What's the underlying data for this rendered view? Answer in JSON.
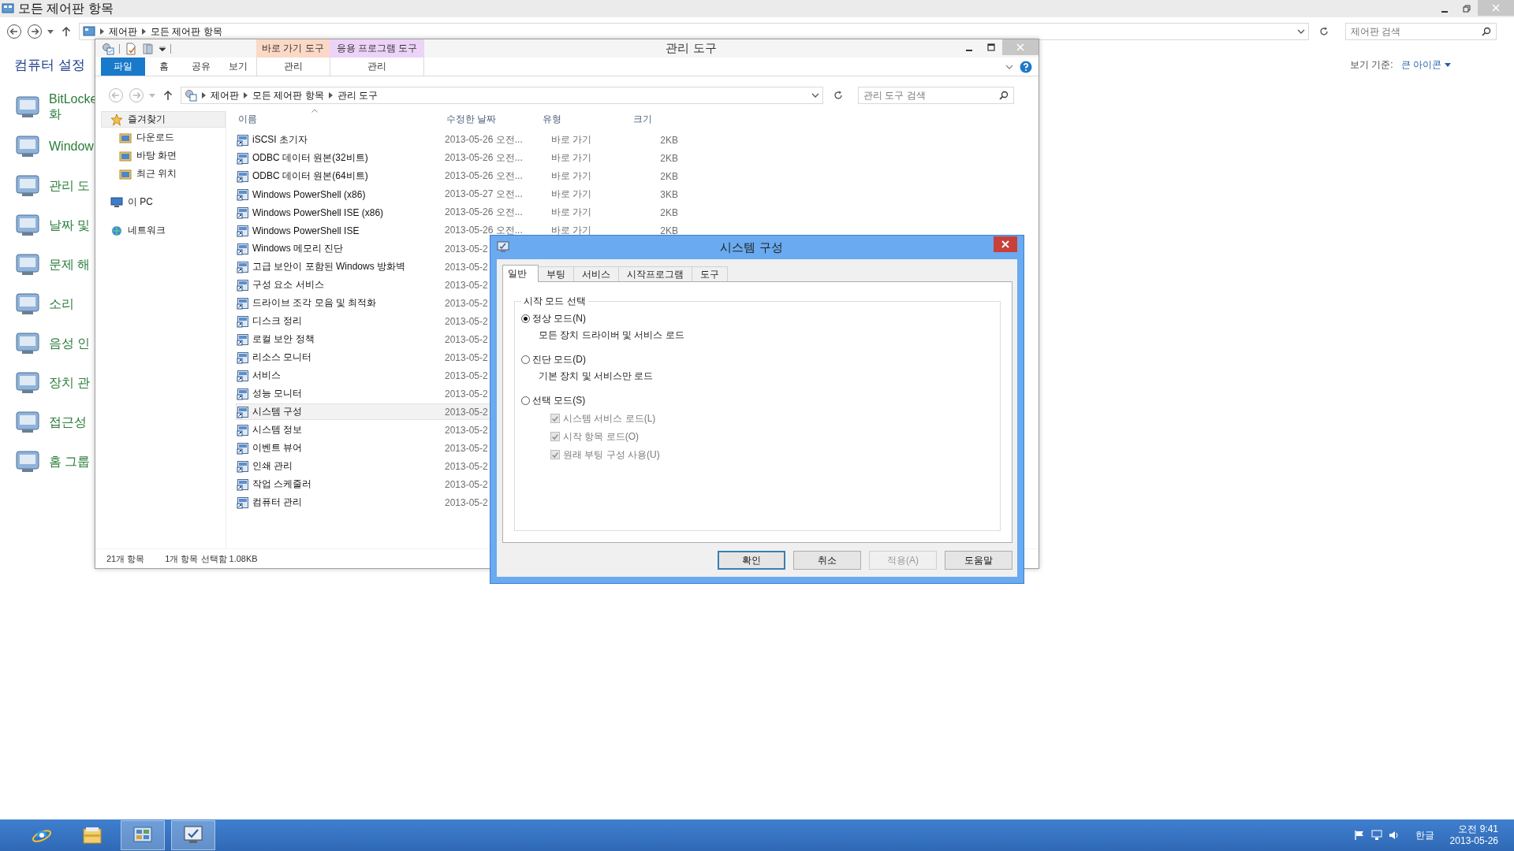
{
  "background_window": {
    "title": "모든 제어판 항목",
    "breadcrumb": [
      "제어판",
      "모든 제어판 항목"
    ],
    "search": {
      "placeholder": "제어판 검색"
    },
    "heading": "컴퓨터 설정",
    "view_by": {
      "label": "보기 기준:",
      "value": "큰 아이콘"
    },
    "items": [
      {
        "lines": [
          "BitLocke",
          "화"
        ]
      },
      {
        "lines": [
          "Window"
        ]
      },
      {
        "lines": [
          "관리 도"
        ]
      },
      {
        "lines": [
          "날짜 및"
        ]
      },
      {
        "lines": [
          "문제 해"
        ]
      },
      {
        "lines": [
          "소리"
        ]
      },
      {
        "lines": [
          "음성 인"
        ]
      },
      {
        "lines": [
          "장치 관"
        ]
      },
      {
        "lines": [
          "접근성"
        ]
      },
      {
        "lines": [
          "홈 그룹"
        ]
      }
    ]
  },
  "explorer": {
    "title": "관리 도구",
    "context_tabs": [
      {
        "label": "바로 가기 도구",
        "color": "#fbd9c6",
        "tab": {
          "label": "관리",
          "selected": false
        }
      },
      {
        "label": "응용 프로그램 도구",
        "color": "#ecd3f7",
        "tab": {
          "label": "관리",
          "selected": false
        }
      }
    ],
    "ribbon_tabs": [
      {
        "label": "파일",
        "selected": true
      },
      {
        "label": "홈",
        "selected": false
      },
      {
        "label": "공유",
        "selected": false
      },
      {
        "label": "보기",
        "selected": false
      }
    ],
    "breadcrumb": [
      "제어판",
      "모든 제어판 항목",
      "관리 도구"
    ],
    "search": {
      "placeholder": "관리 도구 검색"
    },
    "nav": [
      {
        "label": "즐겨찾기",
        "selected": true,
        "children": [
          {
            "label": "다운로드",
            "selected": false
          },
          {
            "label": "바탕 화면",
            "selected": false
          },
          {
            "label": "최근 위치",
            "selected": false
          }
        ]
      },
      {
        "label": "이 PC",
        "selected": false
      },
      {
        "label": "네트워크",
        "selected": false
      }
    ],
    "columns": [
      "이름",
      "수정한 날짜",
      "유형",
      "크기"
    ],
    "rows": [
      {
        "name": "iSCSI 초기자",
        "date": "2013-05-26 오전...",
        "type": "바로 가기",
        "size": "2KB",
        "selected": false
      },
      {
        "name": "ODBC 데이터 원본(32비트)",
        "date": "2013-05-26 오전...",
        "type": "바로 가기",
        "size": "2KB",
        "selected": false
      },
      {
        "name": "ODBC 데이터 원본(64비트)",
        "date": "2013-05-26 오전...",
        "type": "바로 가기",
        "size": "2KB",
        "selected": false
      },
      {
        "name": "Windows PowerShell (x86)",
        "date": "2013-05-27 오전...",
        "type": "바로 가기",
        "size": "3KB",
        "selected": false
      },
      {
        "name": "Windows PowerShell ISE (x86)",
        "date": "2013-05-26 오전...",
        "type": "바로 가기",
        "size": "2KB",
        "selected": false
      },
      {
        "name": "Windows PowerShell ISE",
        "date": "2013-05-26 오전...",
        "type": "바로 가기",
        "size": "2KB",
        "selected": false
      },
      {
        "name": "Windows 메모리 진단",
        "date": "2013-05-2",
        "selected": false
      },
      {
        "name": "고급 보안이 포함된 Windows 방화벽",
        "date": "2013-05-2",
        "selected": false
      },
      {
        "name": "구성 요소 서비스",
        "date": "2013-05-2",
        "selected": false
      },
      {
        "name": "드라이브 조각 모음 및 최적화",
        "date": "2013-05-2",
        "selected": false
      },
      {
        "name": "디스크 정리",
        "date": "2013-05-2",
        "selected": false
      },
      {
        "name": "로컬 보안 정책",
        "date": "2013-05-2",
        "selected": false
      },
      {
        "name": "리소스 모니터",
        "date": "2013-05-2",
        "selected": false
      },
      {
        "name": "서비스",
        "date": "2013-05-2",
        "selected": false
      },
      {
        "name": "성능 모니터",
        "date": "2013-05-2",
        "selected": false
      },
      {
        "name": "시스템 구성",
        "date": "2013-05-2",
        "selected": true
      },
      {
        "name": "시스템 정보",
        "date": "2013-05-2",
        "selected": false
      },
      {
        "name": "이벤트 뷰어",
        "date": "2013-05-2",
        "selected": false
      },
      {
        "name": "인쇄 관리",
        "date": "2013-05-2",
        "selected": false
      },
      {
        "name": "작업 스케줄러",
        "date": "2013-05-2",
        "selected": false
      },
      {
        "name": "컴퓨터 관리",
        "date": "2013-05-2",
        "selected": false
      }
    ],
    "status_bar": [
      "21개 항목",
      "1개 항목 선택함 1.08KB"
    ]
  },
  "dialog": {
    "title": "시스템 구성",
    "tabs": [
      {
        "label": "일반",
        "selected": true
      },
      {
        "label": "부팅",
        "selected": false
      },
      {
        "label": "서비스",
        "selected": false
      },
      {
        "label": "시작프로그램",
        "selected": false
      },
      {
        "label": "도구",
        "selected": false
      }
    ],
    "legend": "시작 모드 선택",
    "options": [
      {
        "label": "정상 모드(N)",
        "selected": true,
        "description": "모든 장치 드라이버 및 서비스 로드"
      },
      {
        "label": "진단 모드(D)",
        "selected": false,
        "description": "기본 장치 및 서비스만 로드"
      },
      {
        "label": "선택 모드(S)",
        "selected": false,
        "checks": [
          {
            "label": "시스템 서비스 로드(L)",
            "checked": true,
            "disabled": true
          },
          {
            "label": "시작 항목 로드(O)",
            "checked": true,
            "disabled": true
          },
          {
            "label": "원래 부팅 구성 사용(U)",
            "checked": true,
            "disabled": true
          }
        ]
      }
    ],
    "buttons": [
      {
        "label": "확인",
        "default": true,
        "disabled": false
      },
      {
        "label": "취소",
        "default": false,
        "disabled": false
      },
      {
        "label": "적용(A)",
        "default": false,
        "disabled": true
      },
      {
        "label": "도움말",
        "default": false,
        "disabled": false
      }
    ]
  },
  "taskbar": {
    "apps": [
      {
        "kind": "browser",
        "active": false
      },
      {
        "kind": "folder",
        "active": false
      },
      {
        "kind": "control-panel",
        "active": true
      },
      {
        "kind": "system-config",
        "active": true
      }
    ],
    "ime": "한글",
    "time": "오전 9:41",
    "date": "2013-05-26"
  }
}
